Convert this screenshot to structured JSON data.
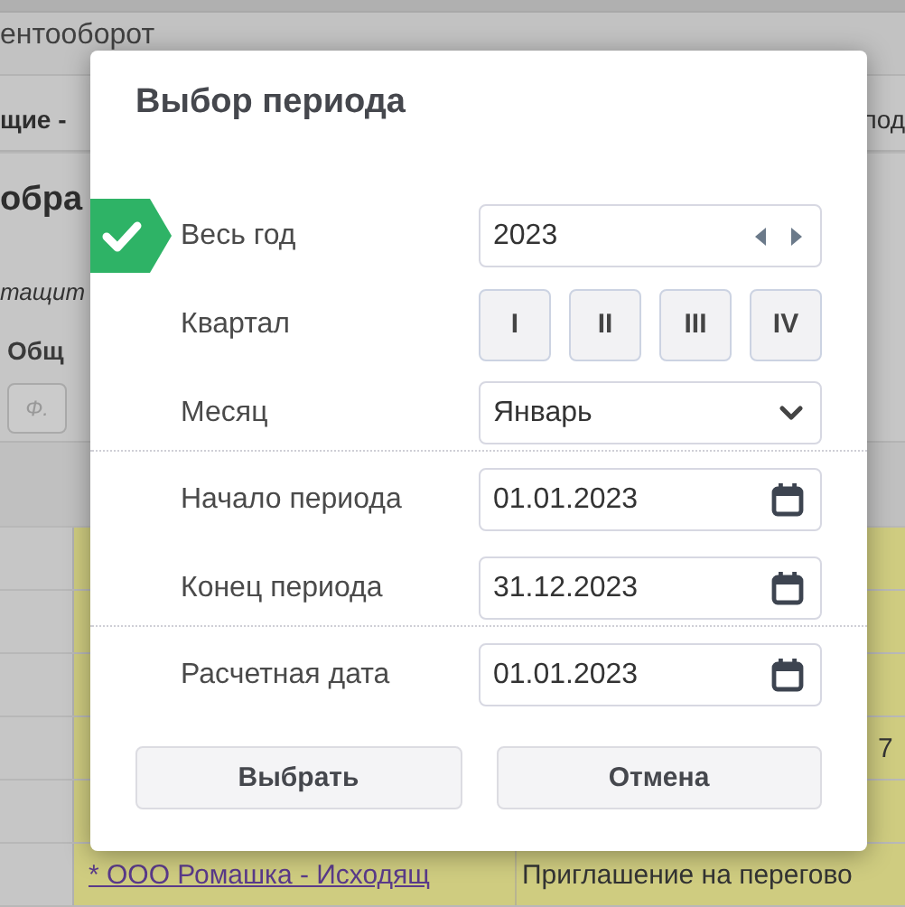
{
  "background": {
    "app_title": "ентооборот",
    "tab_left": "щие - ",
    "tab_right": "под",
    "heading": "обра",
    "subtitle": "тащит",
    "toolbar_label": "Общ",
    "filter_button": "Ф.",
    "table": {
      "note": "7",
      "last_row": {
        "link": "* ООО Ромашка - Исходящ",
        "document": "Приглашение на перегово"
      }
    }
  },
  "dialog": {
    "title": "Выбор периода",
    "rows": [
      {
        "kind": "year",
        "label": "Весь год",
        "selected": true,
        "divider_above": false,
        "value": "2023"
      },
      {
        "kind": "quarters",
        "label": "Квартал",
        "selected": false,
        "divider_above": false,
        "options": [
          {
            "label": "I",
            "selected": false
          },
          {
            "label": "II",
            "selected": false
          },
          {
            "label": "III",
            "selected": false
          },
          {
            "label": "IV",
            "selected": false
          }
        ]
      },
      {
        "kind": "select",
        "label": "Месяц",
        "selected": false,
        "divider_above": false,
        "value": "Январь"
      },
      {
        "kind": "date",
        "label": "Начало периода",
        "selected": false,
        "divider_above": true,
        "value": "01.01.2023"
      },
      {
        "kind": "date",
        "label": "Конец периода",
        "selected": false,
        "divider_above": false,
        "value": "31.12.2023"
      },
      {
        "kind": "date",
        "label": "Расчетная дата",
        "selected": false,
        "divider_above": true,
        "value": "01.01.2023"
      }
    ],
    "buttons": [
      {
        "label": "Выбрать"
      },
      {
        "label": "Отмена"
      }
    ]
  }
}
